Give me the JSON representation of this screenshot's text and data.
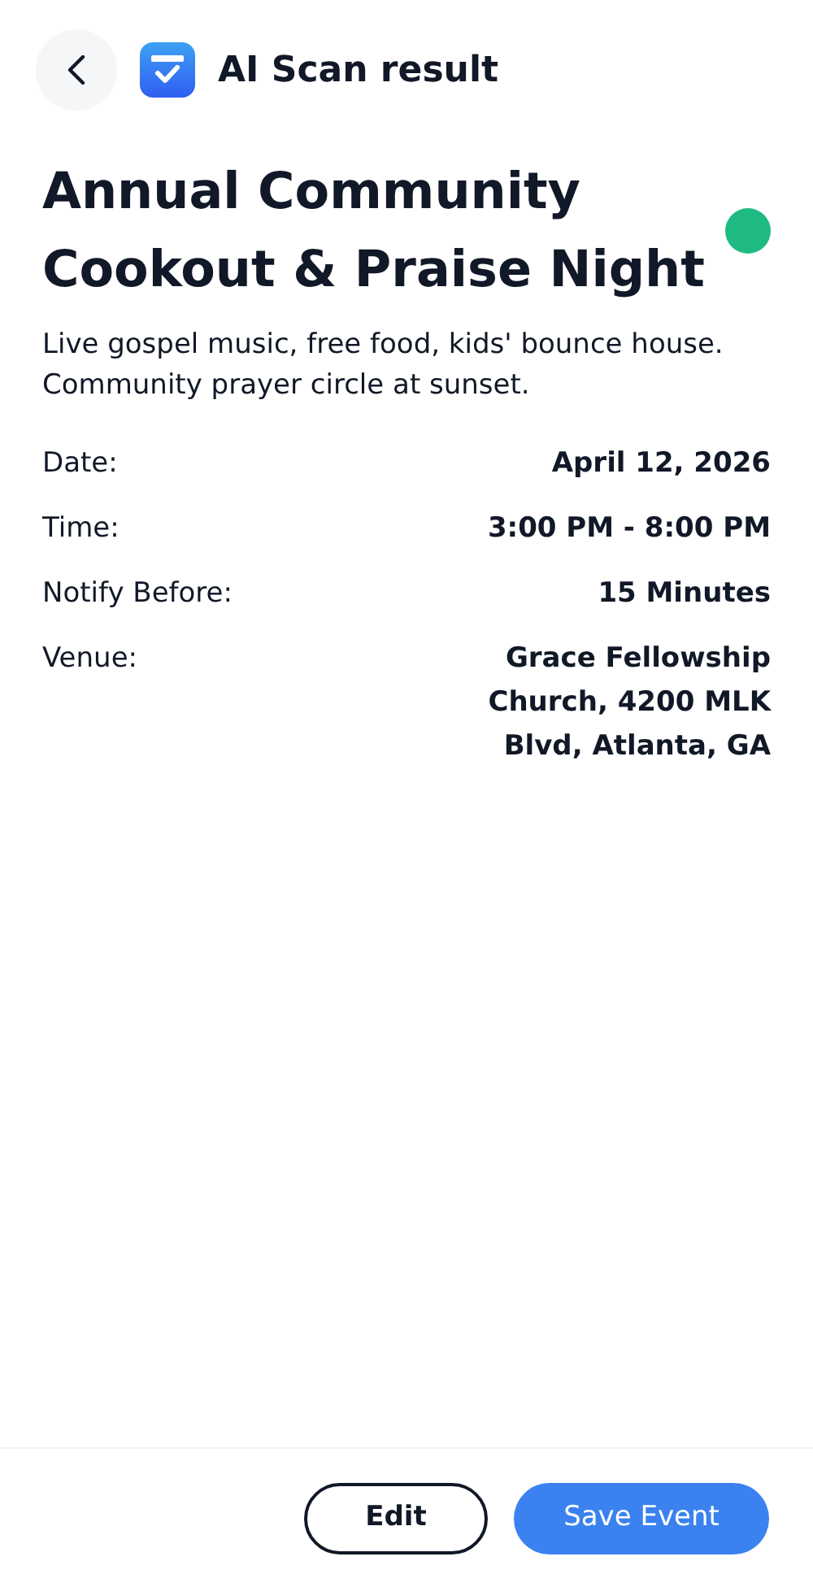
{
  "header": {
    "title": "AI Scan result"
  },
  "event": {
    "title": "Annual Community Cookout & Praise Night",
    "description": "Live gospel music, free food, kids' bounce house. Community prayer circle at sunset.",
    "details": [
      {
        "label": "Date:",
        "value": "April 12, 2026"
      },
      {
        "label": "Time:",
        "value": "3:00 PM - 8:00 PM"
      },
      {
        "label": "Notify Before:",
        "value": "15 Minutes"
      },
      {
        "label": "Venue:",
        "value": "Grace Fellowship Church, 4200 MLK Blvd, Atlanta, GA"
      }
    ]
  },
  "buttons": [
    {
      "label": "Edit",
      "kind": "outline"
    },
    {
      "label": "Save Event",
      "kind": "primary"
    }
  ]
}
